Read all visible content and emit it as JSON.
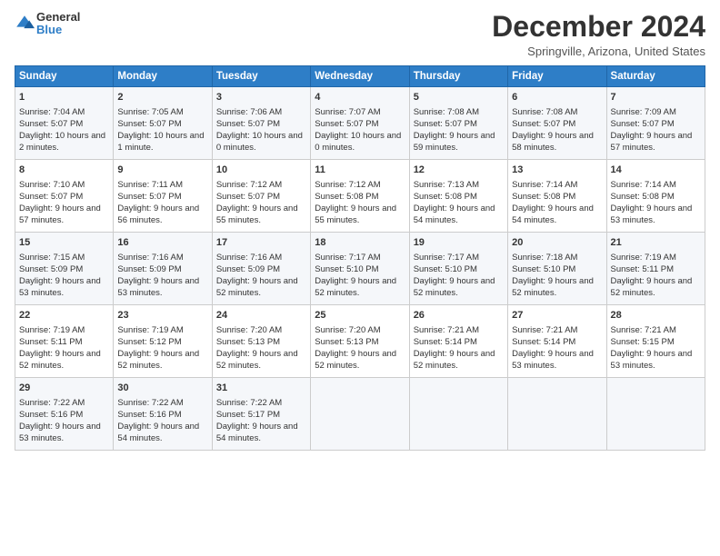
{
  "logo": {
    "general": "General",
    "blue": "Blue"
  },
  "title": "December 2024",
  "location": "Springville, Arizona, United States",
  "days_of_week": [
    "Sunday",
    "Monday",
    "Tuesday",
    "Wednesday",
    "Thursday",
    "Friday",
    "Saturday"
  ],
  "weeks": [
    [
      {
        "day": "1",
        "sunrise": "7:04 AM",
        "sunset": "5:07 PM",
        "daylight": "10 hours and 2 minutes."
      },
      {
        "day": "2",
        "sunrise": "7:05 AM",
        "sunset": "5:07 PM",
        "daylight": "10 hours and 1 minute."
      },
      {
        "day": "3",
        "sunrise": "7:06 AM",
        "sunset": "5:07 PM",
        "daylight": "10 hours and 0 minutes."
      },
      {
        "day": "4",
        "sunrise": "7:07 AM",
        "sunset": "5:07 PM",
        "daylight": "10 hours and 0 minutes."
      },
      {
        "day": "5",
        "sunrise": "7:08 AM",
        "sunset": "5:07 PM",
        "daylight": "9 hours and 59 minutes."
      },
      {
        "day": "6",
        "sunrise": "7:08 AM",
        "sunset": "5:07 PM",
        "daylight": "9 hours and 58 minutes."
      },
      {
        "day": "7",
        "sunrise": "7:09 AM",
        "sunset": "5:07 PM",
        "daylight": "9 hours and 57 minutes."
      }
    ],
    [
      {
        "day": "8",
        "sunrise": "7:10 AM",
        "sunset": "5:07 PM",
        "daylight": "9 hours and 57 minutes."
      },
      {
        "day": "9",
        "sunrise": "7:11 AM",
        "sunset": "5:07 PM",
        "daylight": "9 hours and 56 minutes."
      },
      {
        "day": "10",
        "sunrise": "7:12 AM",
        "sunset": "5:07 PM",
        "daylight": "9 hours and 55 minutes."
      },
      {
        "day": "11",
        "sunrise": "7:12 AM",
        "sunset": "5:08 PM",
        "daylight": "9 hours and 55 minutes."
      },
      {
        "day": "12",
        "sunrise": "7:13 AM",
        "sunset": "5:08 PM",
        "daylight": "9 hours and 54 minutes."
      },
      {
        "day": "13",
        "sunrise": "7:14 AM",
        "sunset": "5:08 PM",
        "daylight": "9 hours and 54 minutes."
      },
      {
        "day": "14",
        "sunrise": "7:14 AM",
        "sunset": "5:08 PM",
        "daylight": "9 hours and 53 minutes."
      }
    ],
    [
      {
        "day": "15",
        "sunrise": "7:15 AM",
        "sunset": "5:09 PM",
        "daylight": "9 hours and 53 minutes."
      },
      {
        "day": "16",
        "sunrise": "7:16 AM",
        "sunset": "5:09 PM",
        "daylight": "9 hours and 53 minutes."
      },
      {
        "day": "17",
        "sunrise": "7:16 AM",
        "sunset": "5:09 PM",
        "daylight": "9 hours and 52 minutes."
      },
      {
        "day": "18",
        "sunrise": "7:17 AM",
        "sunset": "5:10 PM",
        "daylight": "9 hours and 52 minutes."
      },
      {
        "day": "19",
        "sunrise": "7:17 AM",
        "sunset": "5:10 PM",
        "daylight": "9 hours and 52 minutes."
      },
      {
        "day": "20",
        "sunrise": "7:18 AM",
        "sunset": "5:10 PM",
        "daylight": "9 hours and 52 minutes."
      },
      {
        "day": "21",
        "sunrise": "7:19 AM",
        "sunset": "5:11 PM",
        "daylight": "9 hours and 52 minutes."
      }
    ],
    [
      {
        "day": "22",
        "sunrise": "7:19 AM",
        "sunset": "5:11 PM",
        "daylight": "9 hours and 52 minutes."
      },
      {
        "day": "23",
        "sunrise": "7:19 AM",
        "sunset": "5:12 PM",
        "daylight": "9 hours and 52 minutes."
      },
      {
        "day": "24",
        "sunrise": "7:20 AM",
        "sunset": "5:13 PM",
        "daylight": "9 hours and 52 minutes."
      },
      {
        "day": "25",
        "sunrise": "7:20 AM",
        "sunset": "5:13 PM",
        "daylight": "9 hours and 52 minutes."
      },
      {
        "day": "26",
        "sunrise": "7:21 AM",
        "sunset": "5:14 PM",
        "daylight": "9 hours and 52 minutes."
      },
      {
        "day": "27",
        "sunrise": "7:21 AM",
        "sunset": "5:14 PM",
        "daylight": "9 hours and 53 minutes."
      },
      {
        "day": "28",
        "sunrise": "7:21 AM",
        "sunset": "5:15 PM",
        "daylight": "9 hours and 53 minutes."
      }
    ],
    [
      {
        "day": "29",
        "sunrise": "7:22 AM",
        "sunset": "5:16 PM",
        "daylight": "9 hours and 53 minutes."
      },
      {
        "day": "30",
        "sunrise": "7:22 AM",
        "sunset": "5:16 PM",
        "daylight": "9 hours and 54 minutes."
      },
      {
        "day": "31",
        "sunrise": "7:22 AM",
        "sunset": "5:17 PM",
        "daylight": "9 hours and 54 minutes."
      },
      null,
      null,
      null,
      null
    ]
  ]
}
